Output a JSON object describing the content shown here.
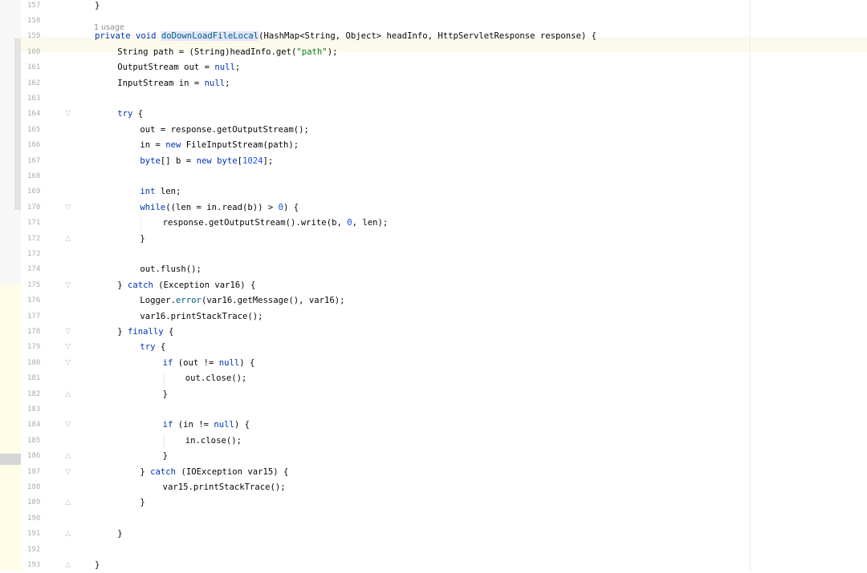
{
  "editor": {
    "usage_hint": "1 usage",
    "lines": [
      {
        "n": "157",
        "fold": "",
        "indent": 0,
        "tokens": [
          [
            "p",
            "}"
          ]
        ]
      },
      {
        "n": "158",
        "fold": "",
        "indent": 0,
        "tokens": []
      },
      {
        "n": "159",
        "fold": "",
        "indent": 0,
        "tokens": [
          [
            "kw",
            "private "
          ],
          [
            "kw",
            "void "
          ],
          [
            "hl",
            "doDownLoadFileLocal"
          ],
          [
            "p",
            "(HashMap<String, Object> headInfo, HttpServletResponse response) {"
          ]
        ]
      },
      {
        "n": "160",
        "fold": "",
        "indent": 1,
        "tokens": [
          [
            "p",
            "String path = (String)headInfo.get("
          ],
          [
            "str",
            "\"path\""
          ],
          [
            "p",
            ");"
          ]
        ]
      },
      {
        "n": "161",
        "fold": "",
        "indent": 1,
        "tokens": [
          [
            "p",
            "OutputStream out = "
          ],
          [
            "kw",
            "null"
          ],
          [
            "p",
            ";"
          ]
        ]
      },
      {
        "n": "162",
        "fold": "",
        "indent": 1,
        "tokens": [
          [
            "p",
            "InputStream in = "
          ],
          [
            "kw",
            "null"
          ],
          [
            "p",
            ";"
          ]
        ]
      },
      {
        "n": "163",
        "fold": "",
        "indent": 0,
        "tokens": []
      },
      {
        "n": "164",
        "fold": "open",
        "indent": 1,
        "tokens": [
          [
            "kw",
            "try"
          ],
          [
            "p",
            " {"
          ]
        ]
      },
      {
        "n": "165",
        "fold": "",
        "indent": 2,
        "tokens": [
          [
            "p",
            "out = response.getOutputStream();"
          ]
        ]
      },
      {
        "n": "166",
        "fold": "",
        "indent": 2,
        "tokens": [
          [
            "p",
            "in = "
          ],
          [
            "kw",
            "new "
          ],
          [
            "p",
            "FileInputStream(path);"
          ]
        ]
      },
      {
        "n": "167",
        "fold": "",
        "indent": 2,
        "tokens": [
          [
            "kw",
            "byte"
          ],
          [
            "p",
            "[] b = "
          ],
          [
            "kw",
            "new "
          ],
          [
            "kw",
            "byte"
          ],
          [
            "p",
            "["
          ],
          [
            "num",
            "1024"
          ],
          [
            "p",
            "];"
          ]
        ]
      },
      {
        "n": "168",
        "fold": "",
        "indent": 0,
        "tokens": []
      },
      {
        "n": "169",
        "fold": "",
        "indent": 2,
        "tokens": [
          [
            "kw",
            "int "
          ],
          [
            "p",
            "len;"
          ]
        ]
      },
      {
        "n": "170",
        "fold": "open",
        "indent": 2,
        "tokens": [
          [
            "kw",
            "while"
          ],
          [
            "p",
            "((len = in.read(b)) > "
          ],
          [
            "num",
            "0"
          ],
          [
            "p",
            ") {"
          ]
        ]
      },
      {
        "n": "171",
        "fold": "",
        "indent": 3,
        "tokens": [
          [
            "p",
            "response.getOutputStream().write(b, "
          ],
          [
            "num",
            "0"
          ],
          [
            "p",
            ", len);"
          ]
        ]
      },
      {
        "n": "172",
        "fold": "close",
        "indent": 2,
        "tokens": [
          [
            "p",
            "}"
          ]
        ]
      },
      {
        "n": "173",
        "fold": "",
        "indent": 0,
        "tokens": []
      },
      {
        "n": "174",
        "fold": "",
        "indent": 2,
        "tokens": [
          [
            "p",
            "out.flush();"
          ]
        ]
      },
      {
        "n": "175",
        "fold": "open",
        "indent": 1,
        "tokens": [
          [
            "p",
            "} "
          ],
          [
            "kw",
            "catch "
          ],
          [
            "p",
            "(Exception var16) {"
          ]
        ]
      },
      {
        "n": "176",
        "fold": "",
        "indent": 2,
        "tokens": [
          [
            "p",
            "Logger."
          ],
          [
            "fn",
            "error"
          ],
          [
            "p",
            "(var16.getMessage(), var16);"
          ]
        ]
      },
      {
        "n": "177",
        "fold": "",
        "indent": 2,
        "tokens": [
          [
            "p",
            "var16.printStackTrace();"
          ]
        ]
      },
      {
        "n": "178",
        "fold": "open",
        "indent": 1,
        "tokens": [
          [
            "p",
            "} "
          ],
          [
            "kw",
            "finally "
          ],
          [
            "p",
            "{"
          ]
        ]
      },
      {
        "n": "179",
        "fold": "open",
        "indent": 2,
        "tokens": [
          [
            "kw",
            "try"
          ],
          [
            "p",
            " {"
          ]
        ]
      },
      {
        "n": "180",
        "fold": "open",
        "indent": 3,
        "tokens": [
          [
            "kw",
            "if "
          ],
          [
            "p",
            "(out != "
          ],
          [
            "kw",
            "null"
          ],
          [
            "p",
            ") {"
          ]
        ]
      },
      {
        "n": "181",
        "fold": "",
        "indent": 4,
        "tokens": [
          [
            "p",
            "out.close();"
          ]
        ]
      },
      {
        "n": "182",
        "fold": "close",
        "indent": 3,
        "tokens": [
          [
            "p",
            "}"
          ]
        ]
      },
      {
        "n": "183",
        "fold": "",
        "indent": 0,
        "tokens": []
      },
      {
        "n": "184",
        "fold": "open",
        "indent": 3,
        "tokens": [
          [
            "kw",
            "if "
          ],
          [
            "p",
            "(in != "
          ],
          [
            "kw",
            "null"
          ],
          [
            "p",
            ") {"
          ]
        ]
      },
      {
        "n": "185",
        "fold": "",
        "indent": 4,
        "tokens": [
          [
            "p",
            "in.close();"
          ]
        ]
      },
      {
        "n": "186",
        "fold": "close",
        "indent": 3,
        "tokens": [
          [
            "p",
            "}"
          ]
        ]
      },
      {
        "n": "187",
        "fold": "open",
        "indent": 2,
        "tokens": [
          [
            "p",
            "} "
          ],
          [
            "kw",
            "catch "
          ],
          [
            "p",
            "(IOException var15) {"
          ]
        ]
      },
      {
        "n": "188",
        "fold": "",
        "indent": 3,
        "tokens": [
          [
            "p",
            "var15.printStackTrace();"
          ]
        ]
      },
      {
        "n": "189",
        "fold": "close",
        "indent": 2,
        "tokens": [
          [
            "p",
            "}"
          ]
        ]
      },
      {
        "n": "190",
        "fold": "",
        "indent": 0,
        "tokens": []
      },
      {
        "n": "191",
        "fold": "close",
        "indent": 1,
        "tokens": [
          [
            "p",
            "}"
          ]
        ]
      },
      {
        "n": "192",
        "fold": "",
        "indent": 0,
        "tokens": []
      },
      {
        "n": "193",
        "fold": "close",
        "indent": 0,
        "tokens": [
          [
            "p",
            "}"
          ]
        ]
      }
    ]
  }
}
